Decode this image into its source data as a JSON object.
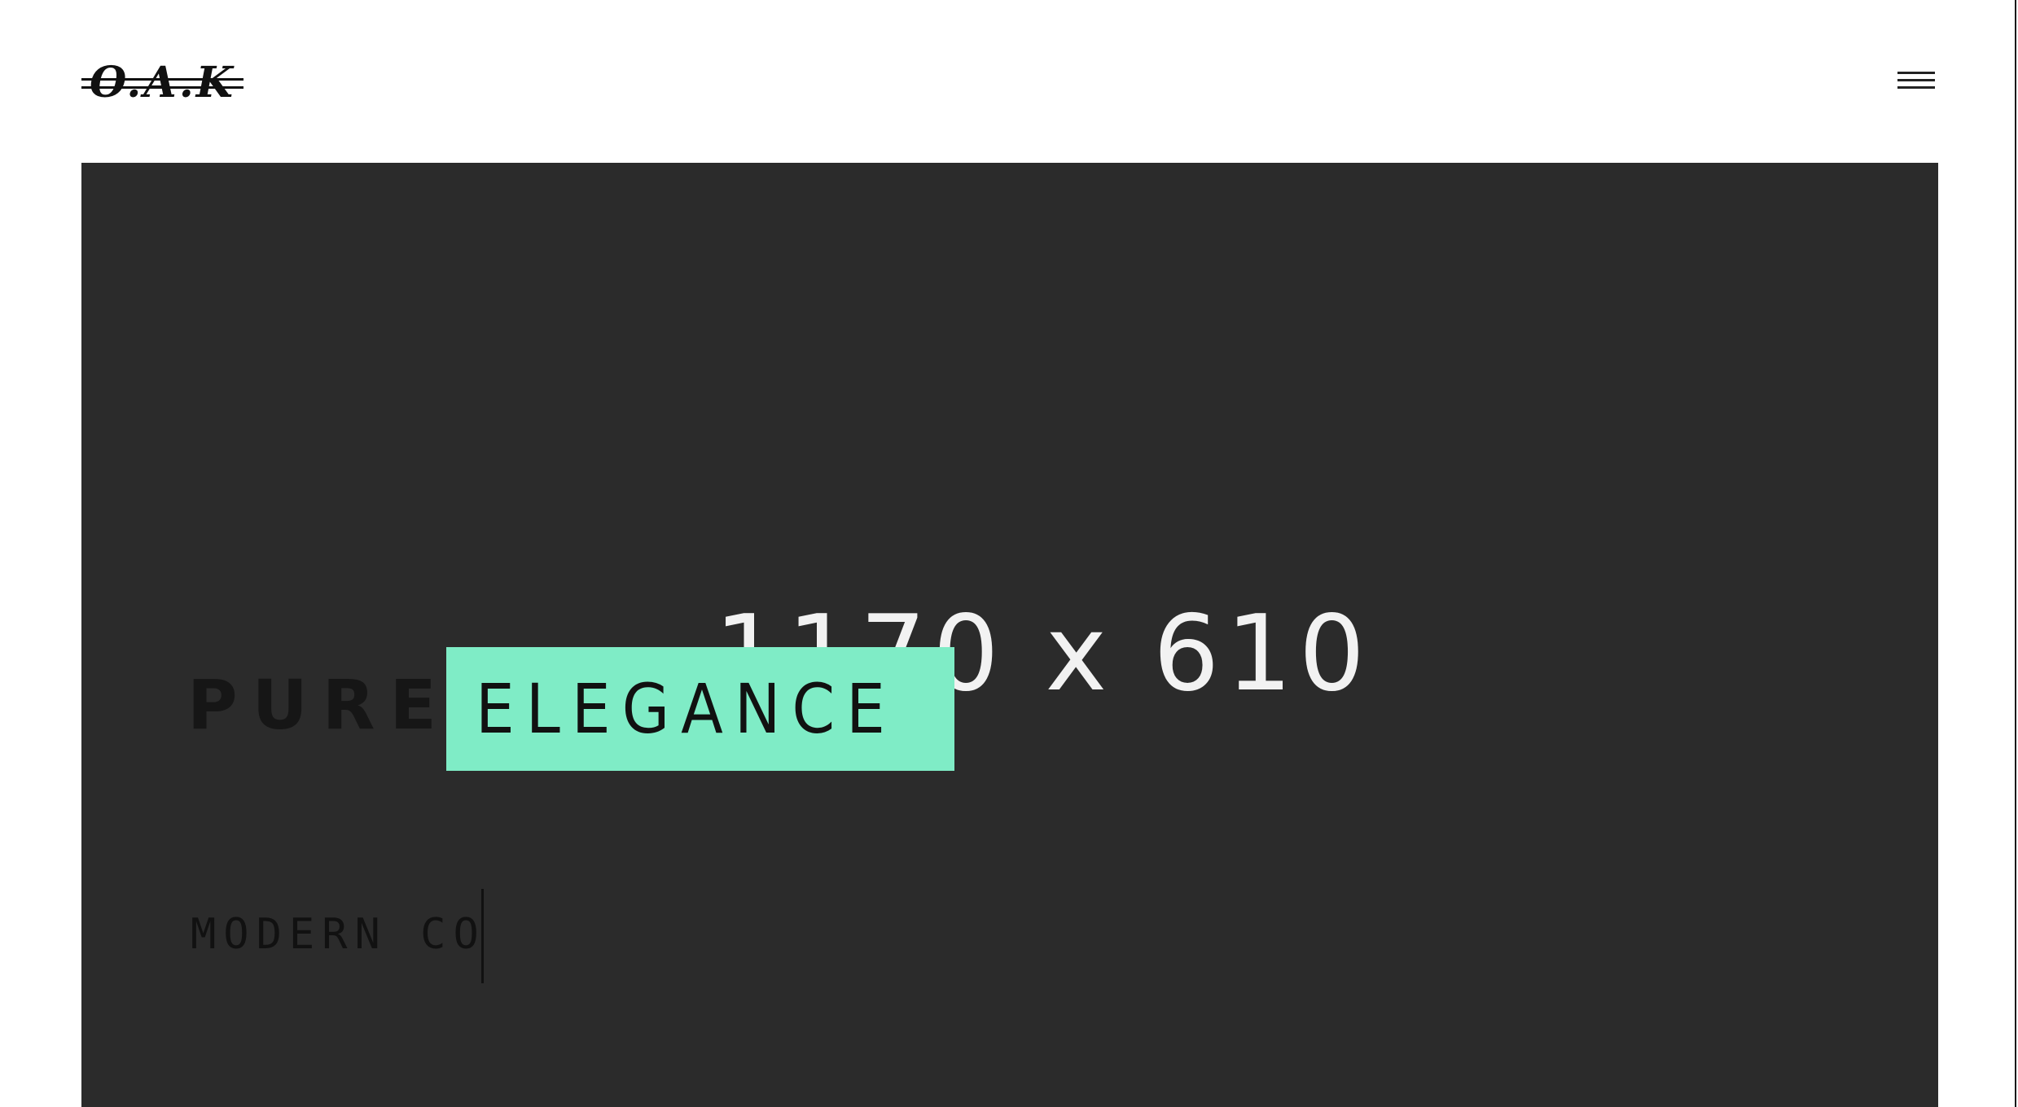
{
  "header": {
    "logo_text": "O.A.K",
    "menu_icon": "hamburger-menu-icon"
  },
  "hero": {
    "placeholder_text": "1170 x 610",
    "headline_bold": "PURE",
    "headline_highlight": "ELEGANCE",
    "subline_typed": "MODERN CO"
  },
  "colors": {
    "hero_background": "#2b2b2b",
    "highlight_background": "#7fecc6",
    "page_background": "#ffffff",
    "text_dark": "#111111"
  }
}
